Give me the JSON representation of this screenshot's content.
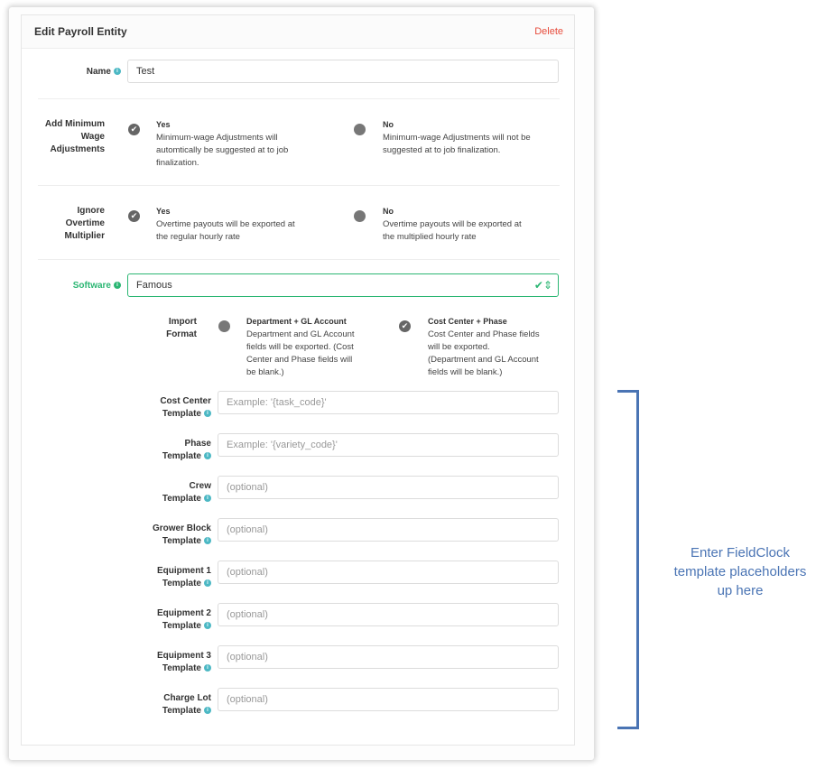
{
  "header": {
    "title": "Edit Payroll Entity",
    "delete_label": "Delete"
  },
  "name": {
    "label": "Name",
    "value": "Test"
  },
  "min_wage": {
    "label_lines": [
      "Add Minimum",
      "Wage",
      "Adjustments"
    ],
    "yes": {
      "title": "Yes",
      "desc_lines": [
        "Minimum-wage Adjustments will",
        "automtically be suggested at to job",
        "finalization."
      ],
      "selected": true
    },
    "no": {
      "title": "No",
      "desc_lines": [
        "Minimum-wage Adjustments will not be",
        "suggested at to job finalization."
      ],
      "selected": false
    }
  },
  "overtime": {
    "label_lines": [
      "Ignore",
      "Overtime",
      "Multiplier"
    ],
    "yes": {
      "title": "Yes",
      "desc_lines": [
        "Overtime payouts will be exported at",
        "the regular hourly rate"
      ],
      "selected": true
    },
    "no": {
      "title": "No",
      "desc_lines": [
        "Overtime payouts will be exported at",
        "the multiplied hourly rate"
      ],
      "selected": false
    }
  },
  "software": {
    "label": "Software",
    "value": "Famous"
  },
  "import_format": {
    "label_lines": [
      "Import",
      "Format"
    ],
    "opt1": {
      "title": "Department + GL Account",
      "desc_lines": [
        "Department and GL Account",
        "fields will be exported. (Cost",
        "Center and Phase fields will",
        "be blank.)"
      ],
      "selected": false
    },
    "opt2": {
      "title": "Cost Center + Phase",
      "desc_lines": [
        "Cost Center and Phase fields",
        "will be exported.",
        "(Department and GL Account",
        "fields will be blank.)"
      ],
      "selected": true
    }
  },
  "templates": [
    {
      "line1": "Cost Center",
      "line2": "Template",
      "placeholder": "Example: '{task_code}'"
    },
    {
      "line1": "Phase",
      "line2": "Template",
      "placeholder": "Example: '{variety_code}'"
    },
    {
      "line1": "Crew",
      "line2": "Template",
      "placeholder": "(optional)"
    },
    {
      "line1": "Grower Block",
      "line2": "Template",
      "placeholder": "(optional)"
    },
    {
      "line1": "Equipment 1",
      "line2": "Template",
      "placeholder": "(optional)"
    },
    {
      "line1": "Equipment 2",
      "line2": "Template",
      "placeholder": "(optional)"
    },
    {
      "line1": "Equipment 3",
      "line2": "Template",
      "placeholder": "(optional)"
    },
    {
      "line1": "Charge Lot",
      "line2": "Template",
      "placeholder": "(optional)"
    }
  ],
  "annotation": {
    "lines": [
      "Enter FieldClock",
      "template placeholders",
      "up here"
    ]
  },
  "icons": {
    "info": "info-icon",
    "check": "check-icon",
    "select_check": "select-check-icon"
  },
  "colors": {
    "accent": "#2bb673",
    "delete": "#e74c3c",
    "annotation": "#4a74b4"
  }
}
